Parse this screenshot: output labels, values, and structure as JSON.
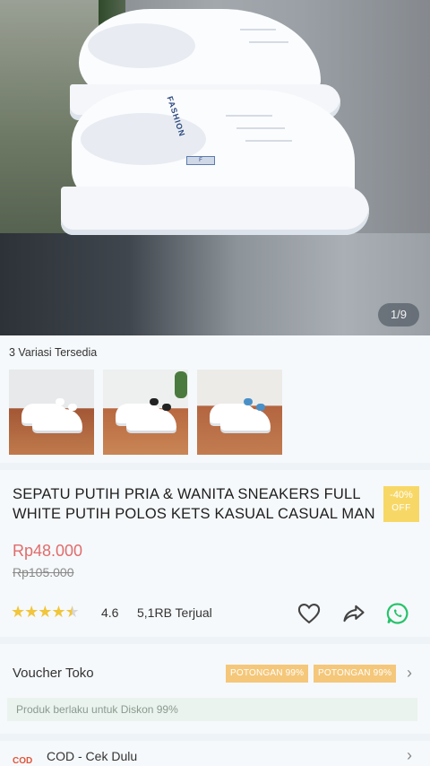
{
  "gallery": {
    "page_counter": "1/9",
    "main_image": "white-sneakers-on-street",
    "shoe_tag": "FASHION"
  },
  "variations": {
    "title": "3 Variasi Tersedia",
    "thumbnails": [
      {
        "name": "white-sneaker-plain",
        "accent": "#ffffff"
      },
      {
        "name": "white-sneaker-black-heel",
        "accent": "#222222"
      },
      {
        "name": "white-sneaker-blue-heel",
        "accent": "#4a90c8"
      }
    ]
  },
  "product": {
    "title": "SEPATU PUTIH PRIA & WANITA SNEAKERS FULL WHITE PUTIH POLOS KETS KASUAL CASUAL MAN",
    "discount": {
      "percent": "-40%",
      "label": "OFF"
    },
    "price": "Rp48.000",
    "original_price": "Rp105.000",
    "rating": {
      "value": "4.6",
      "stars": 4.5
    },
    "sold": "5,1RB Terjual",
    "actions": [
      "heart-icon",
      "share-icon",
      "whatsapp-icon"
    ]
  },
  "voucher": {
    "title": "Voucher Toko",
    "tags": [
      "POTONGAN 99%",
      "POTONGAN 99%"
    ],
    "note": "Produk berlaku untuk Diskon 99%"
  },
  "cod": {
    "icon_text": "COD",
    "label": "COD - Cek Dulu"
  },
  "colors": {
    "price": "#e06c6c",
    "badge": "#f7d867",
    "voucher_tag": "#f4c77a",
    "star": "#f1c53c",
    "whatsapp": "#25c36b"
  }
}
